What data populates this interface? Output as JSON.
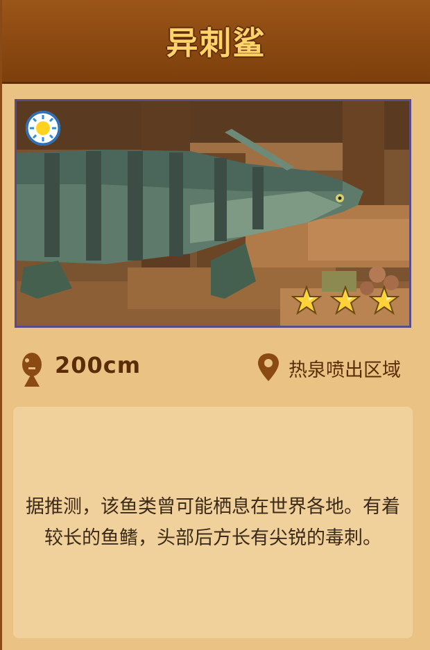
{
  "card": {
    "title": "异刺鲨",
    "size": "200cm",
    "location": "热泉喷出区域",
    "description": "据推测，该鱼类曾可能栖息在世界各地。有着较长的鱼鳍，头部后方长有尖锐的毒刺。",
    "stars": 3,
    "icons": {
      "time_of_day": "sun-icon",
      "size": "fish-silhouette-icon",
      "location": "map-pin-icon",
      "rating": "star-icon"
    }
  },
  "colors": {
    "header": "#8a4a12",
    "title": "#ffd36a",
    "background": "#e9c284",
    "description_box": "#f0d19b",
    "text_dark": "#5c2c06",
    "frame_border": "#5a4a86"
  }
}
